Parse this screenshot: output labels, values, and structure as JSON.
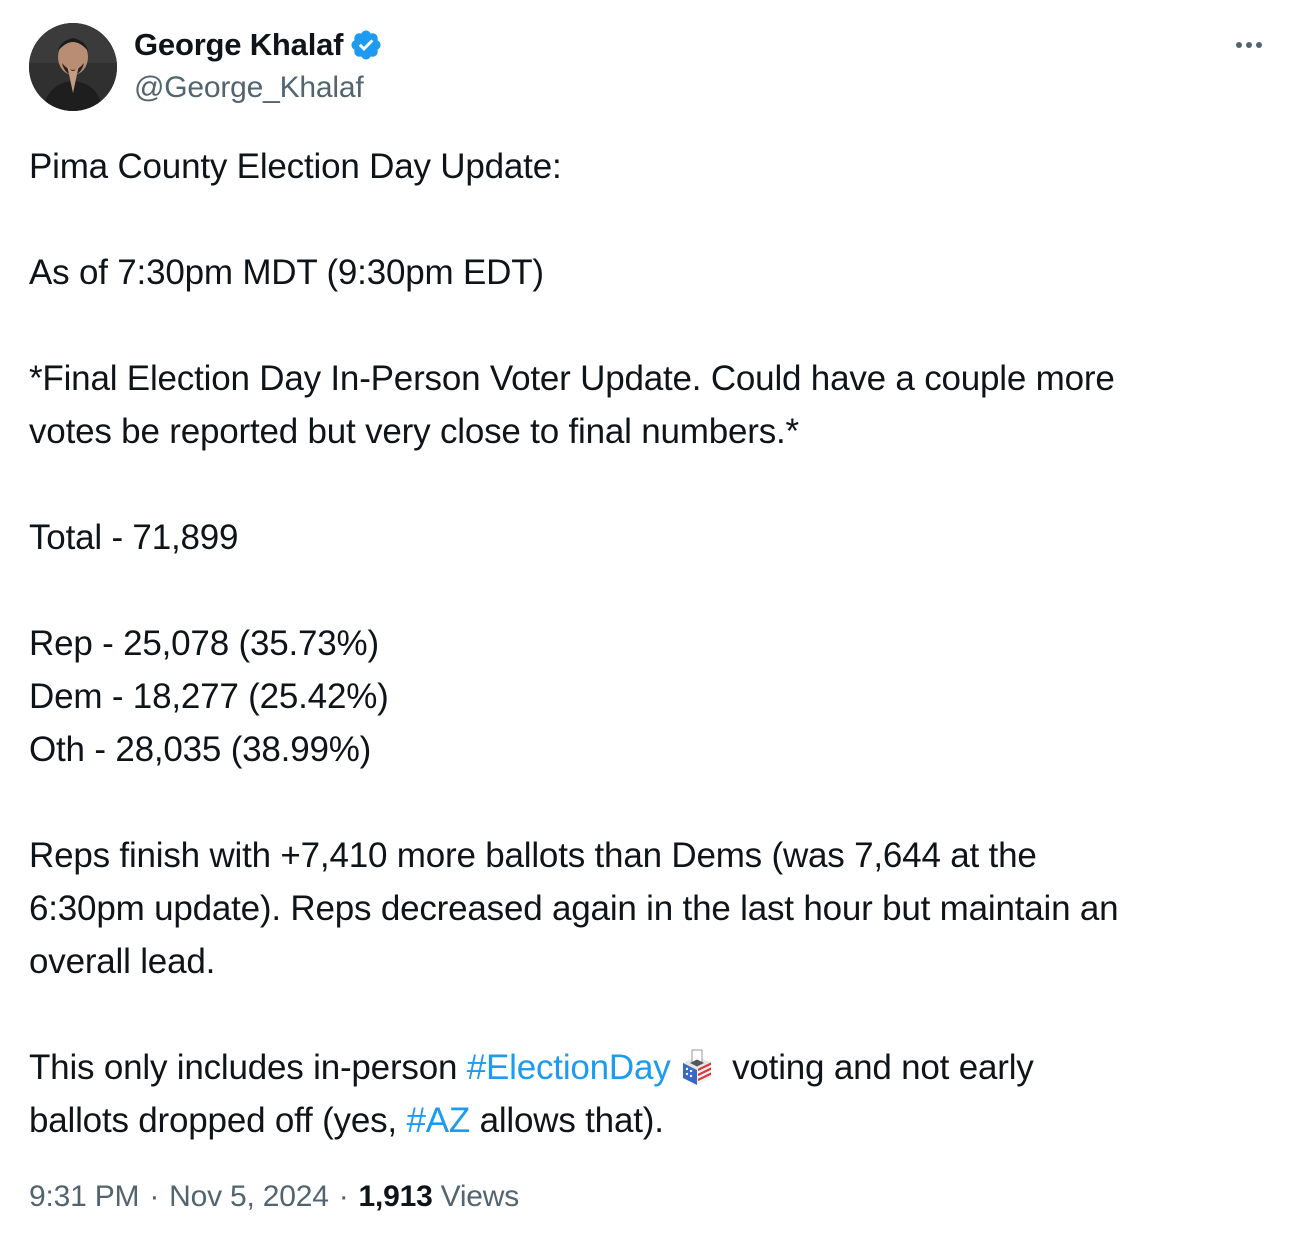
{
  "author": {
    "display_name": "George Khalaf",
    "handle": "@George_Khalaf",
    "verified": true,
    "avatar_icon": "person-hands-clasped-avatar"
  },
  "more_icon": "more-horizontal-icon",
  "tweet": {
    "line1": "Pima County Election Day Update:",
    "line2": "As of 7:30pm MDT (9:30pm EDT)",
    "line3": "*Final Election Day In-Person Voter Update. Could have a couple more",
    "line4": "votes be reported but very close to final numbers.*",
    "total": "Total - 71,899",
    "rep": "Rep - 25,078 (35.73%)",
    "dem": "Dem - 18,277 (25.42%)",
    "oth": "Oth - 28,035 (38.99%)",
    "summary1": "Reps finish with +7,410 more ballots than Dems (was 7,644 at the",
    "summary2": "6:30pm update). Reps decreased again in the last hour but maintain an",
    "summary3": "overall lead.",
    "closing_a": "This only includes in-person ",
    "hashtag1": "#ElectionDay",
    "emoji": "ballot-box-emoji",
    "closing_b": " voting and not early",
    "closing_c": "ballots dropped off (yes, ",
    "hashtag2": "#AZ",
    "closing_d": " allows that)."
  },
  "meta": {
    "time": "9:31 PM",
    "separator": "·",
    "date": "Nov 5, 2024",
    "views_count": "1,913",
    "views_label": "Views"
  },
  "colors": {
    "text": "#0f1419",
    "secondary": "#536471",
    "link": "#1d9bf0",
    "verified": "#1d9bf0"
  }
}
